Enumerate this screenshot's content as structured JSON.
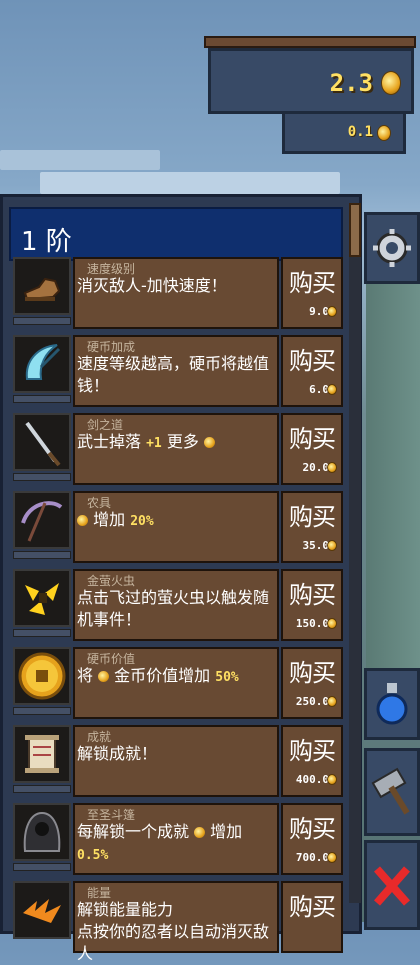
{
  "wallet": {
    "gold": "2.3",
    "rate": "0.1"
  },
  "shop": {
    "tier": "1 阶",
    "buy_label": "购买",
    "items": [
      {
        "name": "速度级别",
        "desc": "消灭敌人-加快速度！",
        "price": "9.0",
        "icon": "boot-icon"
      },
      {
        "name": "硬币加成",
        "desc": "速度等级越高，硬币将越值钱！",
        "price": "6.0",
        "icon": "blade-icon"
      },
      {
        "name": "剑之道",
        "desc_pre": "武士掉落 ",
        "desc_hl": "+1",
        "desc_post": " 更多",
        "price": "20.0",
        "icon": "sword-icon"
      },
      {
        "name": "农具",
        "desc_pre": " 增加 ",
        "desc_hl": "20%",
        "price": "35.0",
        "icon": "scythe-icon"
      },
      {
        "name": "金萤火虫",
        "desc": "点击飞过的萤火虫以触发随机事件！",
        "price": "150.0",
        "icon": "firefly-icon"
      },
      {
        "name": "硬币价值",
        "desc_pre": "将 ",
        "desc_mid": " 金币价值增加 ",
        "desc_hl": "50%",
        "price": "250.0",
        "icon": "gold-coin-icon"
      },
      {
        "name": "成就",
        "desc": "解锁成就！",
        "price": "400.0",
        "icon": "scroll-icon"
      },
      {
        "name": "至圣斗篷",
        "desc_pre": "每解锁一个成就 ",
        "desc_mid": " 增加",
        "desc_hl": "0.5%",
        "price": "700.0",
        "icon": "cloak-icon"
      },
      {
        "name": "能量",
        "desc": "解锁能量能力",
        "desc2": "点按你的忍者以自动消灭敌人",
        "price": "",
        "icon": "energy-icon"
      }
    ]
  },
  "side_tabs": [
    "settings-gear-icon",
    "potion-icon",
    "hammer-icon",
    "close-x-icon"
  ]
}
